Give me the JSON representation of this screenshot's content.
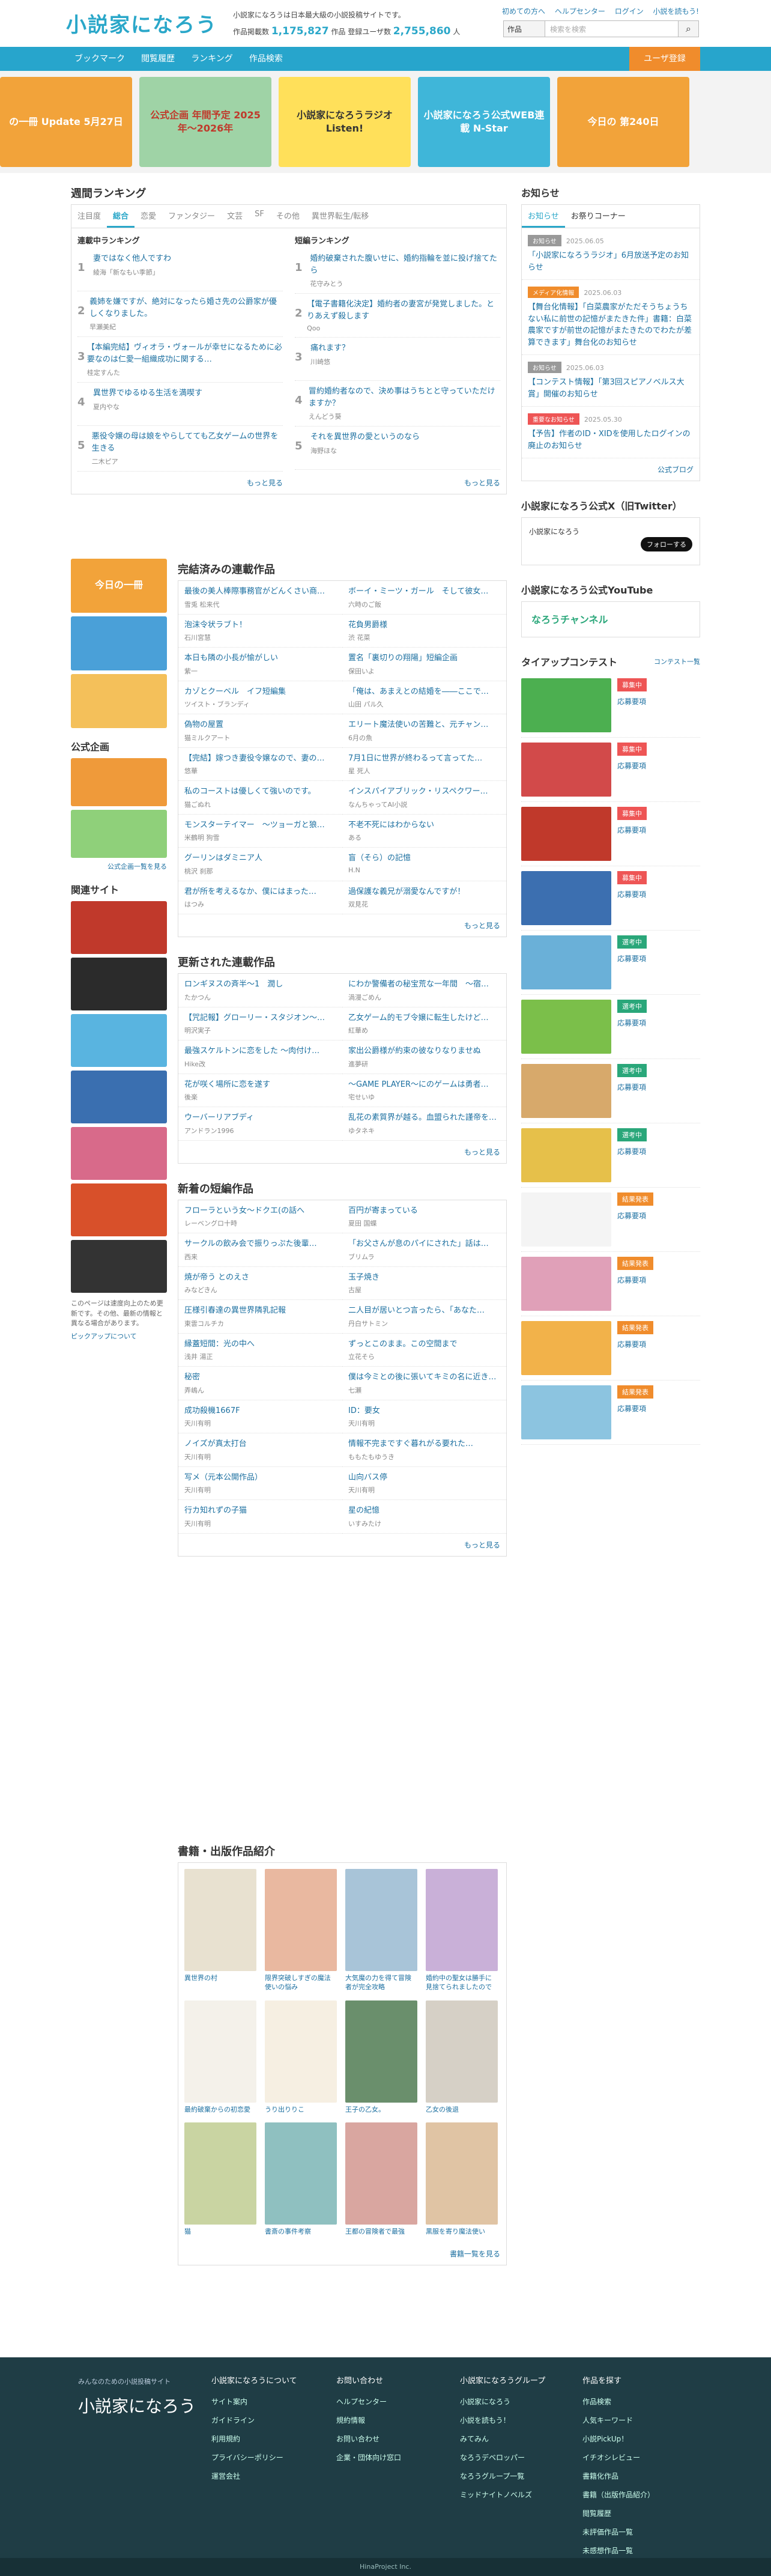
{
  "header": {
    "logo": "小説家になろう",
    "tagline": "小説家になろうは日本最大級の小説投稿サイトです。",
    "stats_label1": "作品掲載数",
    "stats_works": "1,175,827",
    "stats_label2": "作品 登録ユーザ数",
    "stats_users": "2,755,860",
    "stats_label3": "人",
    "toplinks": [
      "初めての方へ",
      "ヘルプセンター",
      "ログイン",
      "小説を読もう!"
    ],
    "search_select": "作品",
    "search_placeholder": "検索を検索"
  },
  "nav": {
    "items": [
      "ブックマーク",
      "閲覧履歴",
      "ランキング",
      "作品検索"
    ],
    "register": "ユーザ登録"
  },
  "banners": [
    {
      "label": "の一冊 Update 5月27日",
      "bg": "#f2a33a",
      "fg": "#fff"
    },
    {
      "label": "公式企画 年間予定 2025年〜2026年",
      "bg": "#9fd3a6",
      "fg": "#c0392b"
    },
    {
      "label": "小説家になろうラジオ Listen!",
      "bg": "#ffe05a",
      "fg": "#333"
    },
    {
      "label": "小説家になろう公式WEB連載 N-Star",
      "bg": "#3fb6d9",
      "fg": "#fff"
    },
    {
      "label": "今日の 第240日",
      "bg": "#f2a33a",
      "fg": "#fff"
    }
  ],
  "ranking": {
    "title": "週間ランキング",
    "tabs": [
      "注目度",
      "総合",
      "恋愛",
      "ファンタジー",
      "文芸",
      "SF",
      "その他",
      "異世界転生/転移"
    ],
    "col1_title": "連載中ランキング",
    "col2_title": "短編ランキング",
    "col1": [
      {
        "no": "1",
        "t": "妻ではなく他人ですわ",
        "a": "綾海「新なもい季節」"
      },
      {
        "no": "2",
        "t": "義姉を嫌ですが、絶対になったら婚さ先の公爵家が優しくなりました。",
        "a": "早瀬美紀"
      },
      {
        "no": "3",
        "t": "【本編完結】ヴィオラ・ヴォールが幸せになるために必要なのは仁愛一組織成功に関する…",
        "a": "桂定すんた"
      },
      {
        "no": "4",
        "t": "異世界でゆるゆる生活を満喫す",
        "a": "夏内やな"
      },
      {
        "no": "5",
        "t": "悪役令嬢の母は娘をやらしてても乙女ゲームの世界を生きる",
        "a": "二木ピア"
      }
    ],
    "col2": [
      {
        "no": "1",
        "t": "婚約破棄された腹いせに、婚約指輪を並に投げ捨てたら",
        "a": "花守みとう"
      },
      {
        "no": "2",
        "t": "【電子書籍化決定】婚約者の妻宮が発覚しました。とりあえず殺します",
        "a": "Qoo"
      },
      {
        "no": "3",
        "t": "痛れます？",
        "a": "川崎悠"
      },
      {
        "no": "4",
        "t": "冒約婚約者なので、決め事はうちとと守っていただけますか？",
        "a": "えんどう葵"
      },
      {
        "no": "5",
        "t": "それを異世界の愛というのなら",
        "a": "海野ほな"
      }
    ],
    "more": "もっと見る"
  },
  "completed": {
    "title": "完結済みの連載作品",
    "items": [
      {
        "t": "最後の美人棒際事務官がどんくさい商…",
        "a": "雪兎 松来代"
      },
      {
        "t": "ボーイ・ミーツ・ガール　そして彼女…",
        "a": "六時のご飯"
      },
      {
        "t": "泡沫令状ラブト！",
        "a": "石川宮慧"
      },
      {
        "t": "花負男爵様",
        "a": "渋 花菜"
      },
      {
        "t": "本日も隣の小長が愉がしい",
        "a": "紫一"
      },
      {
        "t": "置名「裏切りの翔陽」短編企画",
        "a": "保田いよ"
      },
      {
        "t": "カゾとクーベル　イフ短編集",
        "a": "ツイスト・ブランディ"
      },
      {
        "t": "「俺は、あまえとの結婚を――ここで…",
        "a": "山田 パル久"
      },
      {
        "t": "偽物の屋置",
        "a": "猫ミルクアート"
      },
      {
        "t": "エリート魔法使いの苦難と、元チャン…",
        "a": "6月の魚"
      },
      {
        "t": "【完結】嫁つき妻役令嬢なので、妻の…",
        "a": "悠華"
      },
      {
        "t": "7月1日に世界が終わるって言ってた…",
        "a": "星 死人"
      },
      {
        "t": "私のコーストは優しくて強いのです。",
        "a": "猫ごぬれ"
      },
      {
        "t": "インスパイアブリック・リスペクワー…",
        "a": "なんちゃってAI小説"
      },
      {
        "t": "モンスターテイマー　～ツョーガと狼…",
        "a": "米鶴明 狗雪"
      },
      {
        "t": "不老不死にはわからない",
        "a": "ある"
      },
      {
        "t": "グーリンはダミニア人",
        "a": "桃沢 刹那"
      },
      {
        "t": "盲（そら）の記憶",
        "a": "H.N"
      },
      {
        "t": "君が所を考えるなか、僕にはまった…",
        "a": "はつみ"
      },
      {
        "t": "過保護な義兄が溺愛なんですが！",
        "a": "双見花"
      }
    ],
    "more": "もっと見る"
  },
  "updated": {
    "title": "更新された連載作品",
    "items": [
      {
        "t": "ロンギヌスの斉半～1　潤し",
        "a": "たかつん"
      },
      {
        "t": "にわか警備者の秘宝荒な一年間　～宿…",
        "a": "渦漫ごめん"
      },
      {
        "t": "【咒記報】グローリー・スタジオン～…",
        "a": "明沢実子"
      },
      {
        "t": "乙女ゲーム的モブ令嬢に転生したけど…",
        "a": "紅華め"
      },
      {
        "t": "最強スケルトンに恋をした ～肉付け…",
        "a": "Hike改"
      },
      {
        "t": "家出公爵様が約束の彼なりなりませぬ",
        "a": "進夢研"
      },
      {
        "t": "花が咲く場所に恋を遂す",
        "a": "後楽"
      },
      {
        "t": "～GAME PLAYER～にのゲームは勇者…",
        "a": "宅せいゆ"
      },
      {
        "t": "ウーバーリアブディ",
        "a": "アンドラン1996"
      },
      {
        "t": "乱花の素質界が越る。血盟られた謹帝を…",
        "a": "ゆタネキ"
      }
    ],
    "more": "もっと見る"
  },
  "shorts": {
    "title": "新着の短編作品",
    "items": [
      {
        "t": "フローラという女～ドクエ(の話へ",
        "a": "レーベングロ十時"
      },
      {
        "t": "百円が寄まっている",
        "a": "夏田 国蝶"
      },
      {
        "t": "サークルの飲み会で振りっぷた後輩…",
        "a": "西来"
      },
      {
        "t": "「お父さんが息のパイにされた」話は…",
        "a": "ブリムラ"
      },
      {
        "t": "焼が帝う とのえさ",
        "a": "みなどきん"
      },
      {
        "t": "玉子焼き",
        "a": "古屋"
      },
      {
        "t": "圧様引春達の異世界隣乳記報",
        "a": "東雲コルチカ"
      },
      {
        "t": "二人目が居いとつ言ったら、「あなた…",
        "a": "丹白サトミン"
      },
      {
        "t": "縁蓋短間：光の中へ",
        "a": "浅井 湯正"
      },
      {
        "t": "ずっとこのまま。この空間まで",
        "a": "立花そら"
      },
      {
        "t": "秘密",
        "a": "弄嶋ん"
      },
      {
        "t": "僕は今ミとの後に張いてキミの名に近き…",
        "a": "七瀬"
      },
      {
        "t": "成功殺機1667F",
        "a": "天川有明"
      },
      {
        "t": "ID：要女",
        "a": "天川有明"
      },
      {
        "t": "ノイズが真太打台",
        "a": "天川有明"
      },
      {
        "t": "情報不完まですぐ暮れがる要れた…",
        "a": "ももたもゆうき"
      },
      {
        "t": "写メ（元本公開作品）",
        "a": "天川有明"
      },
      {
        "t": "山向バス停",
        "a": "天川有明"
      },
      {
        "t": "行カ知れずの子猫",
        "a": "天川有明"
      },
      {
        "t": "星の紀憶",
        "a": "いすみたけ"
      }
    ],
    "more": "もっと見る"
  },
  "books": {
    "title": "書籍・出版作品紹介",
    "items": [
      {
        "t": "異世界の村",
        "bg": "#e8e1d0"
      },
      {
        "t": "限界突破しすぎの魔法使いの悩み",
        "bg": "#e9b8a0"
      },
      {
        "t": "大気魔の力を得て冒険者が完全攻略",
        "bg": "#a8c4d8"
      },
      {
        "t": "婚約中の聖女は勝手に見捨てられましたので",
        "bg": "#c9b0d8"
      },
      {
        "t": "最約破棄からの初恋愛",
        "bg": "#f4f1ea"
      },
      {
        "t": "うり出りりこ",
        "bg": "#f6efe2"
      },
      {
        "t": "王子の乙女。",
        "bg": "#6a8f6c"
      },
      {
        "t": "乙女の後退",
        "bg": "#d6d0c6"
      },
      {
        "t": "猫",
        "bg": "#c9d4a2"
      },
      {
        "t": "書斎の事件考察",
        "bg": "#8fc0c0"
      },
      {
        "t": "王都の冒険者で最強",
        "bg": "#d9a6a0"
      },
      {
        "t": "黒服を寄り魔法使い",
        "bg": "#e0c4a4"
      }
    ],
    "more": "書籍一覧を見る"
  },
  "left": {
    "pickup_label": "今日の一冊",
    "official_title": "公式企画",
    "official_link": "公式企画一覧を見る",
    "related_title": "関連サイト",
    "note": "このページは速度向上のため更新です。その他、最新の情報と異なる場合があります。",
    "note_link": "ピックアップについて"
  },
  "news": {
    "title": "お知らせ",
    "tabs": [
      "お知らせ",
      "お祭りコーナー"
    ],
    "items": [
      {
        "badge": "お知らせ",
        "color": "#999",
        "date": "2025.06.05",
        "t": "「小説家になろうラジオ」6月放送予定のお知らせ"
      },
      {
        "badge": "メディア化情報",
        "color": "#f08c2c",
        "date": "2025.06.03",
        "t": "【舞台化情報】「白菜農家がただそうちょうちない私に前世の記憶がまたきた件」書籍：白菜農家ですが前世の記憶がまたきたのでわたが差算できます」舞台化のお知らせ"
      },
      {
        "badge": "お知らせ",
        "color": "#999",
        "date": "2025.06.03",
        "t": "【コンテスト情報】「第3回スピアノベルス大賞」開催のお知らせ"
      },
      {
        "badge": "重要なお知らせ",
        "color": "#e55",
        "date": "2025.05.30",
        "t": "【予告】作者のID・XIDを使用したログインの廃止のお知らせ"
      }
    ],
    "more": "公式ブログ"
  },
  "twitter": {
    "title": "小説家になろう公式X（旧Twitter）",
    "handle": "小説家になろう",
    "follow": "フォローする"
  },
  "youtube": {
    "title": "小説家になろう公式YouTube",
    "label": "なろうチャンネル"
  },
  "tieup": {
    "title": "タイアップコンテスト",
    "link": "コンテスト一覧",
    "items": [
      {
        "status": "募集中",
        "sc": "#e55",
        "img": "#4caf50",
        "lk": "応募要項"
      },
      {
        "status": "募集中",
        "sc": "#e55",
        "img": "#d24a4a",
        "lk": "応募要項"
      },
      {
        "status": "募集中",
        "sc": "#e55",
        "img": "#c0392b",
        "lk": "応募要項"
      },
      {
        "status": "募集中",
        "sc": "#e55",
        "img": "#3c6fb0",
        "lk": "応募要項"
      },
      {
        "status": "選考中",
        "sc": "#2aa77a",
        "img": "#6ab0d8",
        "lk": "応募要項"
      },
      {
        "status": "選考中",
        "sc": "#2aa77a",
        "img": "#7bbf4a",
        "lk": "応募要項"
      },
      {
        "status": "選考中",
        "sc": "#2aa77a",
        "img": "#d7a96b",
        "lk": "応募要項"
      },
      {
        "status": "選考中",
        "sc": "#2aa77a",
        "img": "#e6c04a",
        "lk": "応募要項"
      },
      {
        "status": "結果発表",
        "sc": "#f08c2c",
        "img": "#f4f4f4",
        "lk": "応募要項"
      },
      {
        "status": "結果発表",
        "sc": "#f08c2c",
        "img": "#e0a0b8",
        "lk": "応募要項"
      },
      {
        "status": "結果発表",
        "sc": "#f08c2c",
        "img": "#f2b24a",
        "lk": "応募要項"
      },
      {
        "status": "結果発表",
        "sc": "#f08c2c",
        "img": "#8cc4e0",
        "lk": "応募要項"
      }
    ]
  },
  "footer": {
    "sub": "みんなのための小説投稿サイト",
    "logo": "小説家になろう",
    "col1_title": "小説家になろうについて",
    "col1": [
      "サイト案内",
      "ガイドライン",
      "利用規約",
      "プライバシーポリシー",
      "運営会社"
    ],
    "col2_title": "お問い合わせ",
    "col2": [
      "ヘルプセンター",
      "規約情報",
      "お問い合わせ",
      "企業・団体向け窓口"
    ],
    "col3_title": "小説家になろうグループ",
    "col3": [
      "小説家になろう",
      "小説を読もう！",
      "みてみん",
      "なろうデベロッパー",
      "なろうグループ一覧",
      "ミッドナイトノベルズ"
    ],
    "col4_title": "作品を探す",
    "col4": [
      "作品検索",
      "人気キーワード",
      "小説PickUp！",
      "イチオシレビュー",
      "書籍化作品",
      "書籍（出版作品紹介）",
      "閲覧履歴",
      "未評価作品一覧",
      "未感想作品一覧"
    ],
    "copy": "HinaProject Inc."
  }
}
